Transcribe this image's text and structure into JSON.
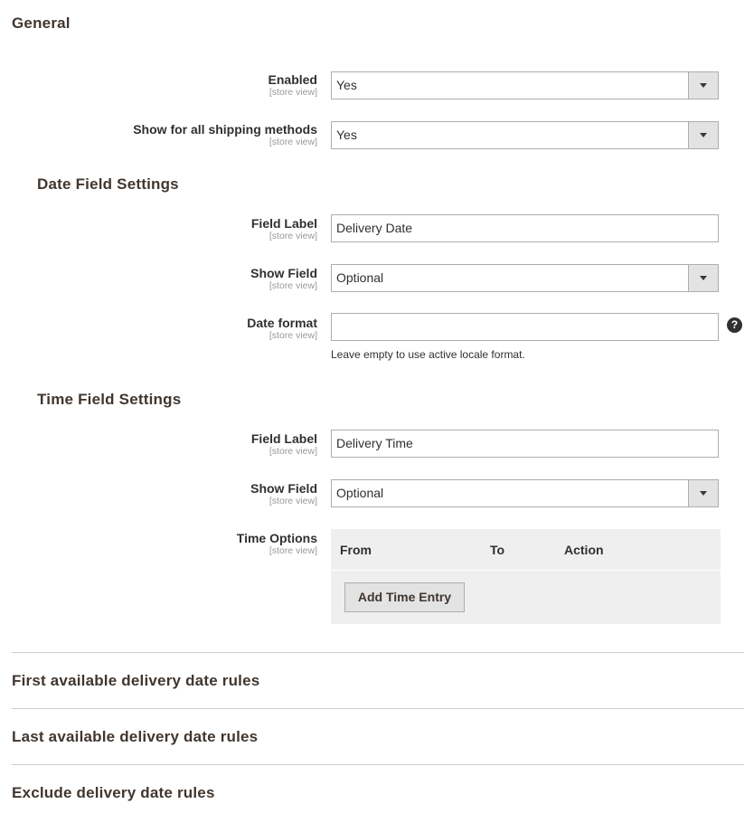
{
  "general": {
    "title": "General",
    "enabled": {
      "label": "Enabled",
      "scope": "[store view]",
      "value": "Yes"
    },
    "show_all": {
      "label": "Show for all shipping methods",
      "scope": "[store view]",
      "value": "Yes"
    }
  },
  "date_settings": {
    "title": "Date Field Settings",
    "field_label": {
      "label": "Field Label",
      "scope": "[store view]",
      "value": "Delivery Date"
    },
    "show_field": {
      "label": "Show Field",
      "scope": "[store view]",
      "value": "Optional"
    },
    "date_format": {
      "label": "Date format",
      "scope": "[store view]",
      "value": "",
      "note": "Leave empty to use active locale format.",
      "help_icon": "question-circle-icon"
    }
  },
  "time_settings": {
    "title": "Time Field Settings",
    "field_label": {
      "label": "Field Label",
      "scope": "[store view]",
      "value": "Delivery Time"
    },
    "show_field": {
      "label": "Show Field",
      "scope": "[store view]",
      "value": "Optional"
    },
    "time_options": {
      "label": "Time Options",
      "scope": "[store view]",
      "columns": [
        "From",
        "To",
        "Action"
      ],
      "add_button": "Add Time Entry"
    }
  },
  "sections": [
    "First available delivery date rules",
    "Last available delivery date rules",
    "Exclude delivery date rules"
  ]
}
